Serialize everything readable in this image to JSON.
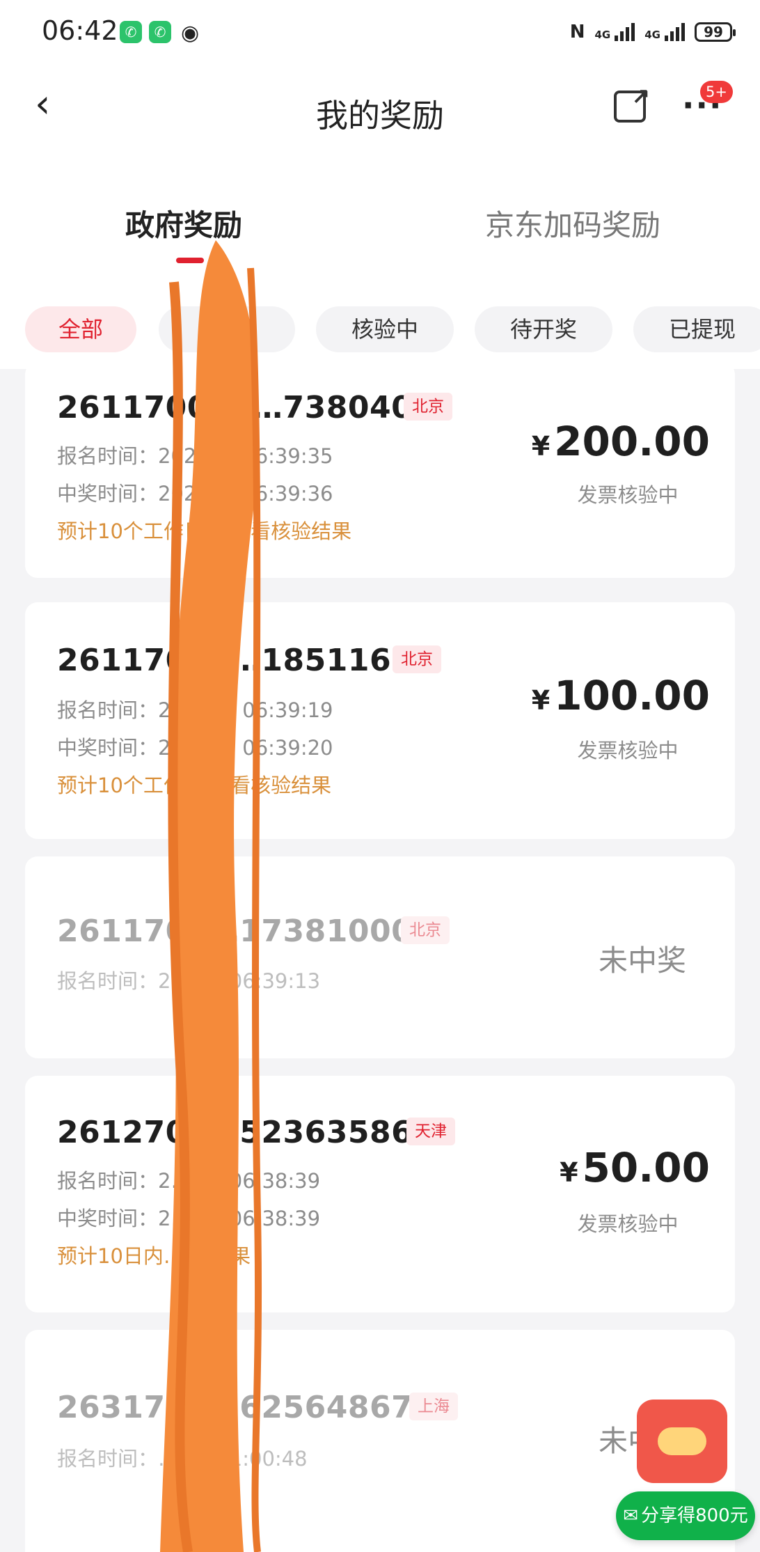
{
  "status_bar": {
    "time": "06:42",
    "nfc": "N",
    "net1": "4G",
    "net2": "4G",
    "battery": "99"
  },
  "header": {
    "title": "我的奖励",
    "badge": "5+"
  },
  "tabs": [
    {
      "label": "政府奖励",
      "active": true
    },
    {
      "label": "京东加码奖励",
      "active": false
    }
  ],
  "filters": [
    {
      "label": "全部",
      "active": true
    },
    {
      "label": "待…",
      "active": false
    },
    {
      "label": "核验中",
      "active": false
    },
    {
      "label": "待开奖",
      "active": false
    },
    {
      "label": "已提现",
      "active": false
    }
  ],
  "records": [
    {
      "number": "261170000…7380406",
      "region": "北京",
      "signup": "报名时间：202… 2 06:39:35",
      "win": "中奖时间：202… 2 06:39:36",
      "tip": "预计10个工作日… 查看核验结果",
      "currency": "¥",
      "amount": "200.00",
      "status": "发票核验中"
    },
    {
      "number": "26117000…18511614",
      "region": "北京",
      "signup": "报名时间：20… 02 06:39:19",
      "win": "中奖时间：20… 02 06:39:20",
      "tip": "预计10个工作… 查看核验结果",
      "currency": "¥",
      "amount": "100.00",
      "status": "发票核验中"
    },
    {
      "number": "2611700…17381000",
      "region": "北京",
      "signup": "报名时间：2… 02 06:39:13",
      "result": "未中奖"
    },
    {
      "number": "2612700…52363586",
      "region": "天津",
      "signup": "报名时间：2… 02 06:38:39",
      "win": "中奖时间：2… 02 06:38:39",
      "tip": "预计10日内… 验结果",
      "currency": "¥",
      "amount": "50.00",
      "status": "发票核验中"
    },
    {
      "number": "2631700…62564867",
      "region": "上海",
      "signup": "报名时间：… 01 21:00:48",
      "result": "未中奖"
    }
  ],
  "promo": {
    "label": "分享得800元"
  },
  "colors": {
    "accent": "#e0212f",
    "tip": "#d9903b",
    "muted": "#8c8c8c",
    "redaction": "#f58a3a",
    "promo": "#10b14a"
  }
}
